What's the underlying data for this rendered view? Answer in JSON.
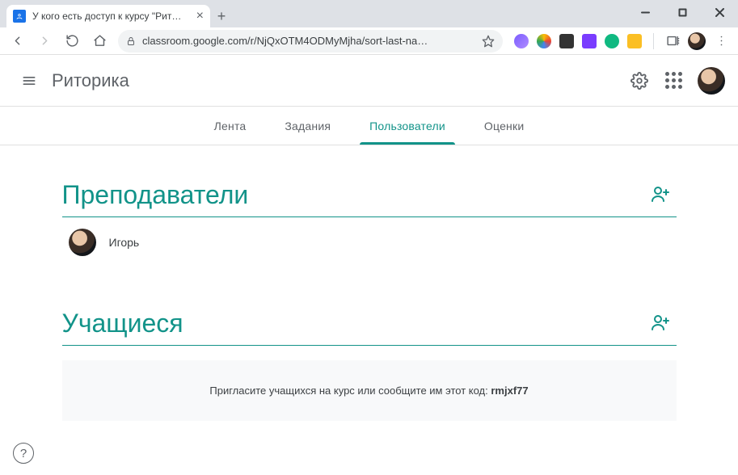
{
  "browser": {
    "tab_title": "У кого есть доступ к курсу \"Рит…",
    "url": "classroom.google.com/r/NjQxOTM4ODMyMjha/sort-last-na…"
  },
  "header": {
    "class_title": "Риторика"
  },
  "tabs": {
    "stream": "Лента",
    "classwork": "Задания",
    "people": "Пользователи",
    "grades": "Оценки"
  },
  "sections": {
    "teachers": {
      "title": "Преподаватели"
    },
    "students": {
      "title": "Учащиеся"
    }
  },
  "teachers": [
    {
      "name": "Игорь"
    }
  ],
  "students_empty": {
    "prefix": "Пригласите учащихся на курс или сообщите им этот код: ",
    "code": "rmjxf77"
  },
  "help": {
    "label": "?"
  }
}
